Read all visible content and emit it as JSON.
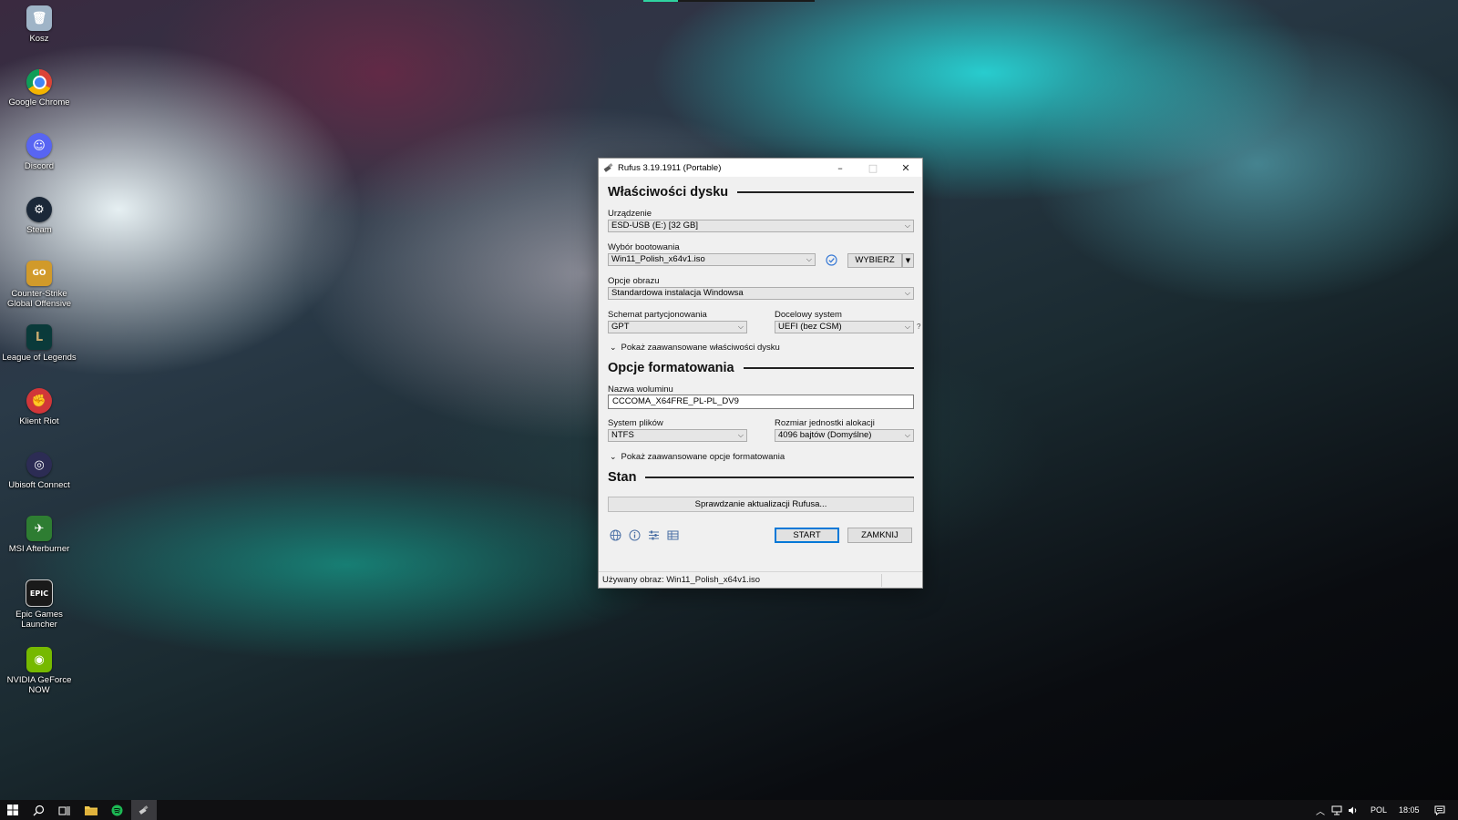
{
  "desktop": {
    "icons": [
      {
        "label": "Kosz",
        "icon": "recycle-bin-icon",
        "color": "#9fb4c7"
      },
      {
        "label": "Google Chrome",
        "icon": "chrome-icon",
        "color": "#db4437"
      },
      {
        "label": "Discord",
        "icon": "discord-icon",
        "color": "#5865f2"
      },
      {
        "label": "Steam",
        "icon": "steam-icon",
        "color": "#1b2838"
      },
      {
        "label": "Counter-Strike Global Offensive",
        "icon": "csgo-icon",
        "color": "#d19a2a"
      },
      {
        "label": "League of Legends",
        "icon": "league-icon",
        "color": "#0a3a3a"
      },
      {
        "label": "Klient Riot",
        "icon": "riot-icon",
        "color": "#d13639"
      },
      {
        "label": "Ubisoft Connect",
        "icon": "ubisoft-icon",
        "color": "#2c2c54"
      },
      {
        "label": "MSI Afterburner",
        "icon": "afterburner-icon",
        "color": "#2e7d32"
      },
      {
        "label": "Epic Games Launcher",
        "icon": "epic-icon",
        "color": "#1a1a1a"
      },
      {
        "label": "NVIDIA GeForce NOW",
        "icon": "nvidia-icon",
        "color": "#76b900"
      }
    ]
  },
  "window": {
    "title": "Rufus 3.19.1911 (Portable)",
    "controls": {
      "minimize": "–",
      "maximize": "□",
      "close": "✕"
    },
    "drive_section": {
      "heading": "Właściwości dysku",
      "device_label": "Urządzenie",
      "device_value": "ESD-USB (E:) [32 GB]",
      "boot_label": "Wybór bootowania",
      "boot_value": "Win11_Polish_x64v1.iso",
      "select_button": "WYBIERZ",
      "image_option_label": "Opcje obrazu",
      "image_option_value": "Standardowa instalacja Windowsa",
      "partition_label": "Schemat partycjonowania",
      "partition_value": "GPT",
      "target_label": "Docelowy system",
      "target_value": "UEFI (bez CSM)",
      "help_mark": "?",
      "advanced_toggle": "Pokaż zaawansowane właściwości dysku"
    },
    "format_section": {
      "heading": "Opcje formatowania",
      "volume_label": "Nazwa woluminu",
      "volume_value": "CCCOMA_X64FRE_PL-PL_DV9",
      "fs_label": "System plików",
      "fs_value": "NTFS",
      "cluster_label": "Rozmiar jednostki alokacji",
      "cluster_value": "4096 bajtów (Domyślne)",
      "advanced_toggle": "Pokaż zaawansowane opcje formatowania"
    },
    "status_section": {
      "heading": "Stan",
      "progress_text": "Sprawdzanie aktualizacji Rufusa..."
    },
    "buttons": {
      "start": "START",
      "close": "ZAMKNIJ"
    },
    "statusbar": "Używany obraz: Win11_Polish_x64v1.iso"
  },
  "taskbar": {
    "language": "POL",
    "time": "18:05"
  }
}
